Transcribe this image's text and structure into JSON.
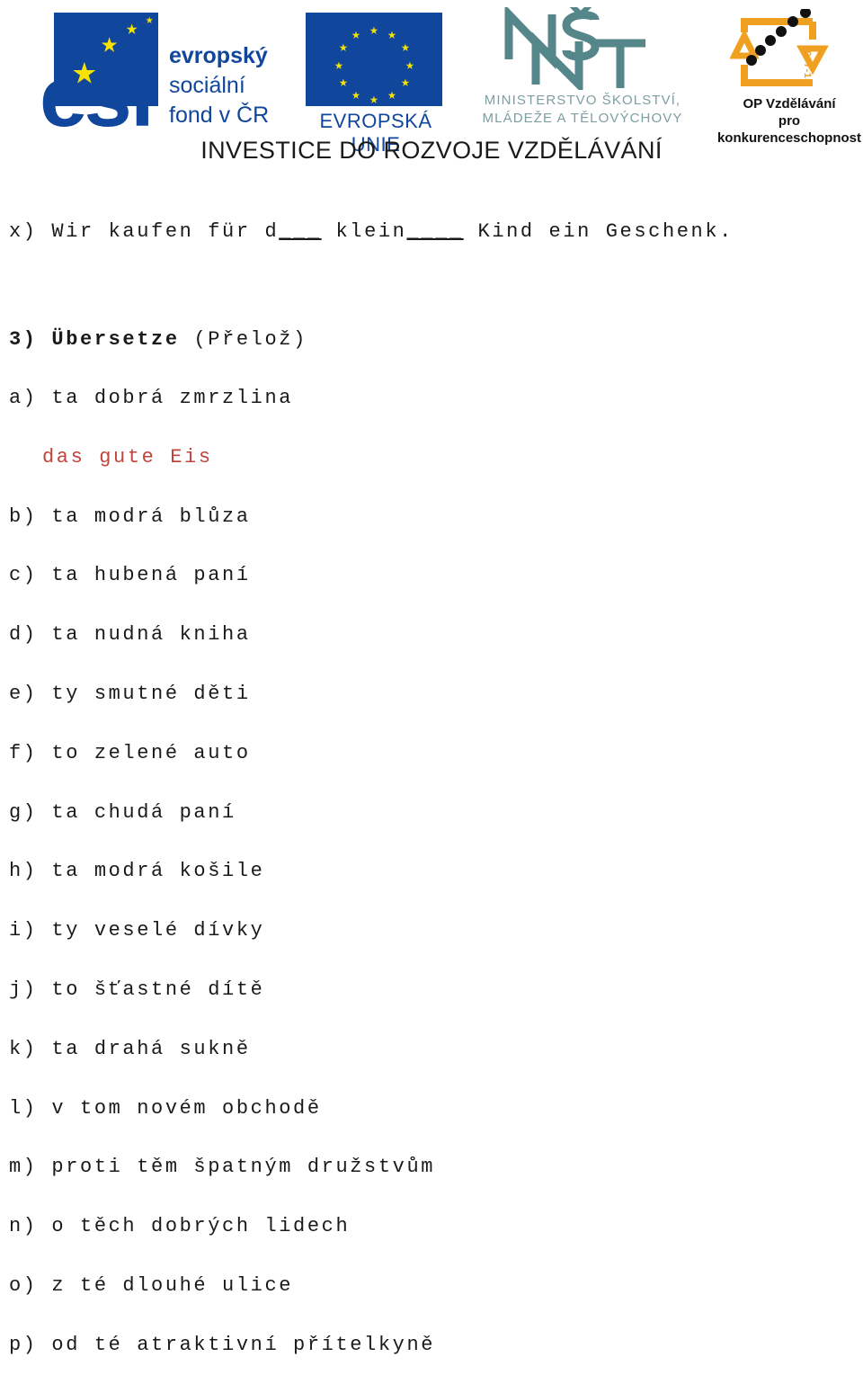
{
  "header": {
    "esf": {
      "logo_letters": "esf",
      "line1": "evropský",
      "line2": "sociální",
      "line3": "fond v ČR",
      "icon": "esf-stars-icon"
    },
    "eu": {
      "label": "EVROPSKÁ UNIE",
      "icon": "eu-flag-icon"
    },
    "msmt": {
      "mark": "MŠMT",
      "line1": "MINISTERSTVO ŠKOLSTVÍ,",
      "line2": "MLÁDEŽE A TĚLOVÝCHOVY",
      "icon": "msmt-monogram-icon"
    },
    "op": {
      "year": "2007-13",
      "line1": "OP Vzdělávání",
      "line2": "pro konkurenceschopnost",
      "icon": "op-arrows-icon"
    },
    "tagline": "INVESTICE DO ROZVOJE VZDĚLÁVÁNÍ"
  },
  "exercise_prev": {
    "label": "x)",
    "text_before": " Wir kaufen für d",
    "blank1": "___",
    "text_mid": " klein",
    "blank2": "____",
    "text_after": " Kind ein Geschenk."
  },
  "task": {
    "number": "3)",
    "title": "Übersetze",
    "translation": "(Přelož)"
  },
  "items": [
    {
      "label": "a)",
      "text": " ta dobrá zmrzlina",
      "answer": "das gute Eis"
    },
    {
      "label": "b)",
      "text": " ta modrá blůza",
      "answer": ""
    },
    {
      "label": "c)",
      "text": " ta hubená paní",
      "answer": ""
    },
    {
      "label": "d)",
      "text": " ta nudná kniha",
      "answer": ""
    },
    {
      "label": "e)",
      "text": " ty smutné děti",
      "answer": ""
    },
    {
      "label": "f)",
      "text": " to zelené auto",
      "answer": ""
    },
    {
      "label": "g)",
      "text": " ta chudá paní",
      "answer": ""
    },
    {
      "label": "h)",
      "text": " ta modrá košile",
      "answer": ""
    },
    {
      "label": "i)",
      "text": " ty veselé dívky",
      "answer": ""
    },
    {
      "label": "j)",
      "text": " to šťastné dítě",
      "answer": ""
    },
    {
      "label": "k)",
      "text": " ta drahá sukně",
      "answer": ""
    },
    {
      "label": "l)",
      "text": " v tom novém obchodě",
      "answer": ""
    },
    {
      "label": "m)",
      "text": " proti těm špatným družstvům",
      "answer": ""
    },
    {
      "label": "n)",
      "text": " o těch dobrých lidech",
      "answer": ""
    },
    {
      "label": "o)",
      "text": " z té dlouhé ulice",
      "answer": ""
    },
    {
      "label": "p)",
      "text": " od té atraktivní přítelkyně",
      "answer": ""
    }
  ],
  "colors": {
    "answer_red": "#c0453c",
    "eu_blue": "#10469b",
    "star_yellow": "#f6e200",
    "msmt_teal": "#55868a",
    "op_orange": "#f0a020"
  }
}
